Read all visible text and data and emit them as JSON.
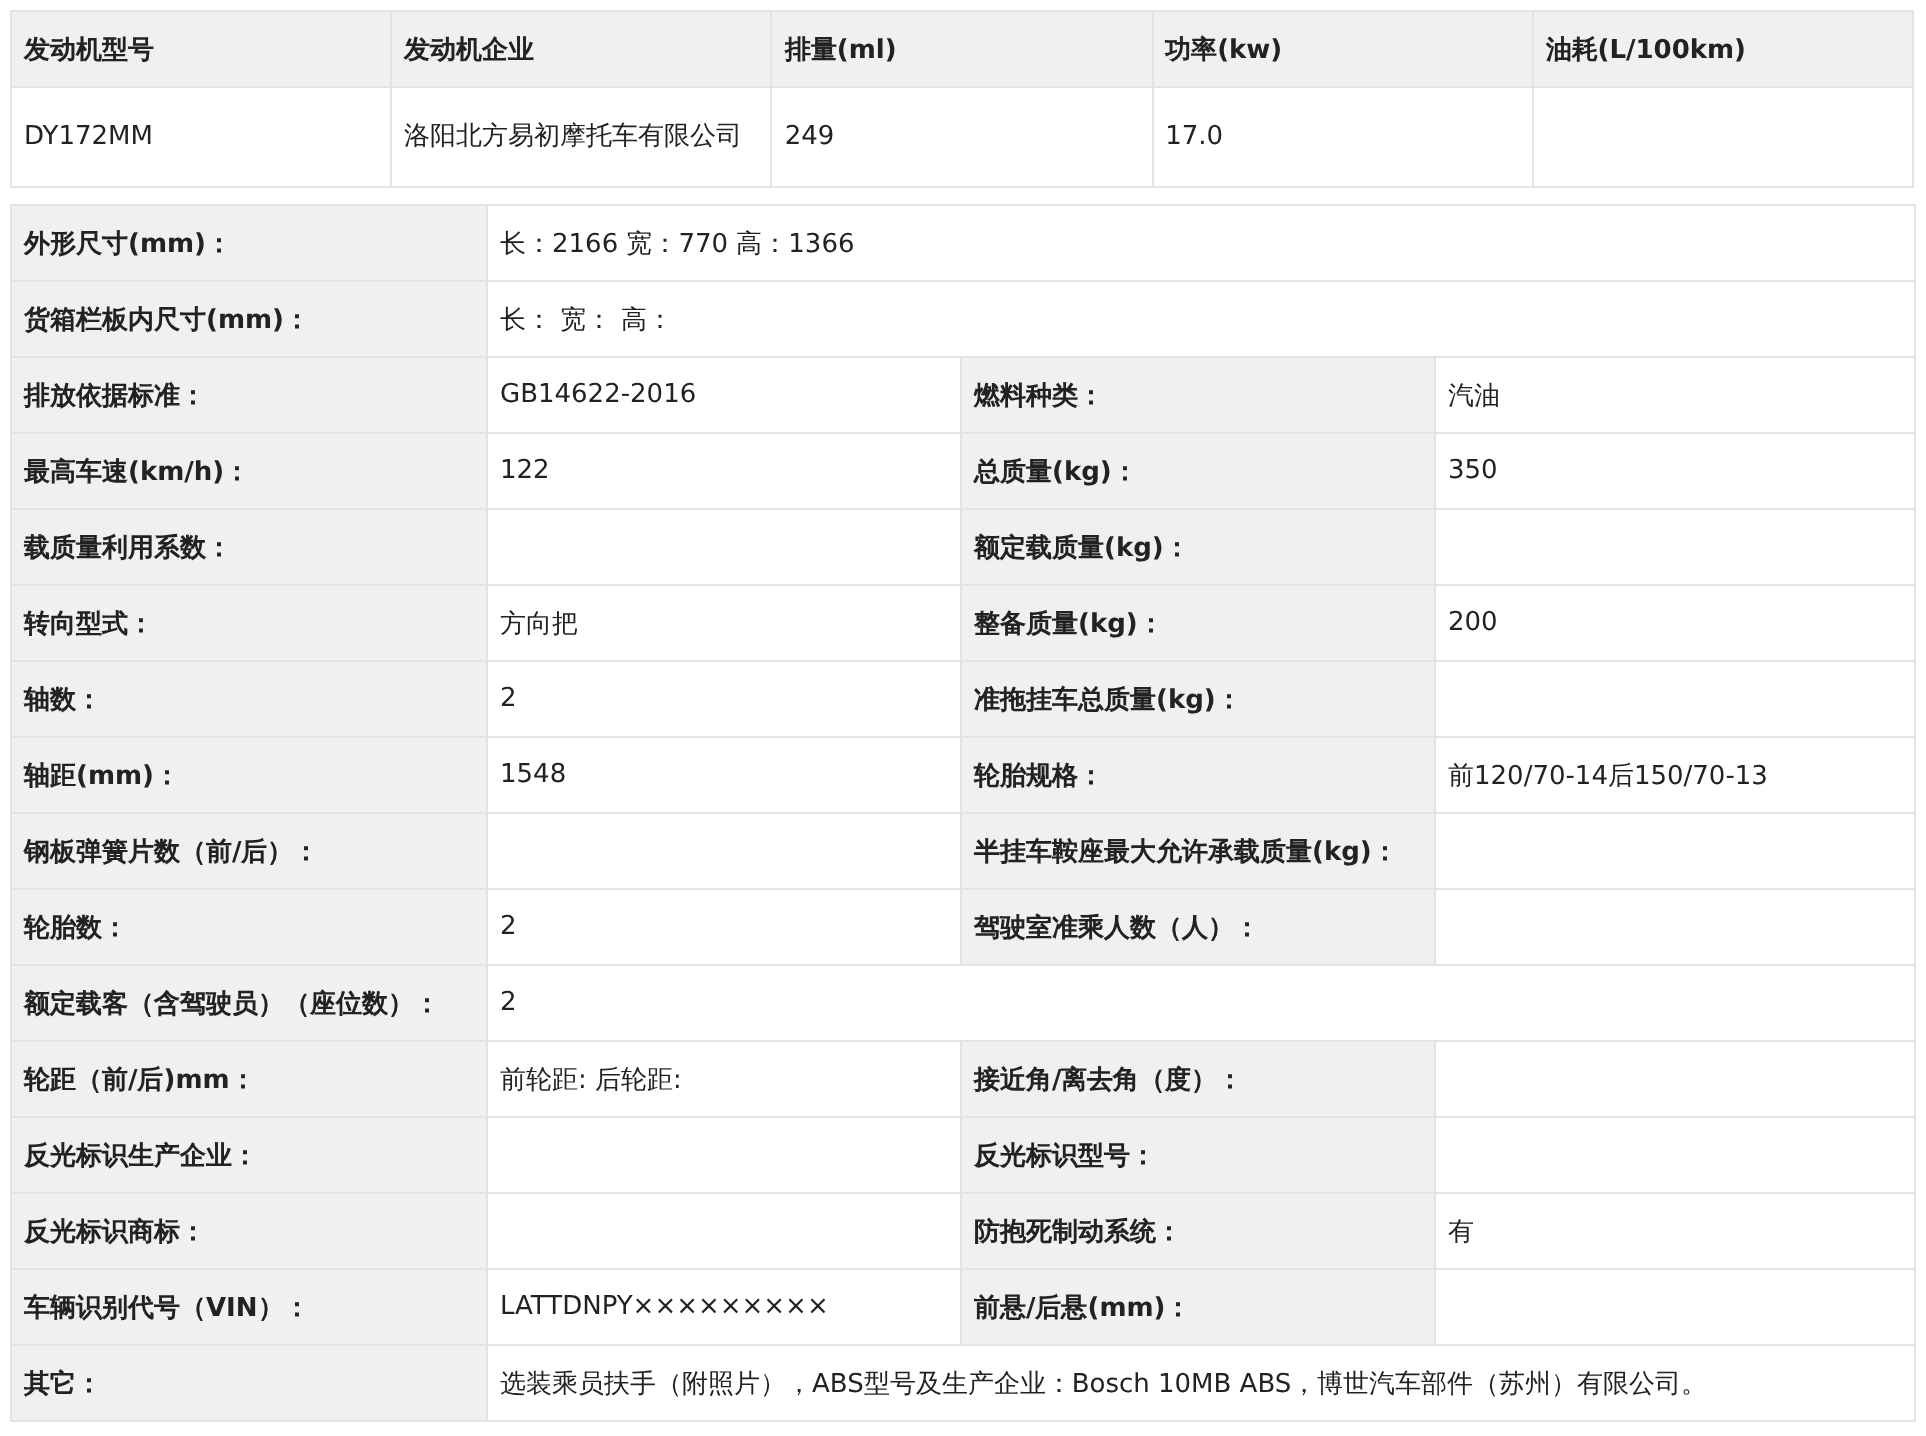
{
  "engine_table": {
    "columns": [
      "发动机型号",
      "发动机企业",
      "排量(ml)",
      "功率(kw)",
      "油耗(L/100km)"
    ],
    "rows": [
      {
        "cells": [
          "DY172MM",
          "洛阳北方易初摩托车有限公司",
          "249",
          "17.0",
          ""
        ]
      }
    ]
  },
  "spec_table": {
    "rows": [
      {
        "kind": "wide",
        "label": "外形尺寸(mm)：",
        "value": "长：2166 宽：770 高：1366"
      },
      {
        "kind": "wide",
        "label": "货箱栏板内尺寸(mm)：",
        "value": "长： 宽： 高："
      },
      {
        "kind": "pair",
        "label": "排放依据标准：",
        "value": "GB14622-2016",
        "label_2": "燃料种类：",
        "value_2": "汽油"
      },
      {
        "kind": "pair",
        "label": "最高车速(km/h)：",
        "value": "122",
        "label_2": "总质量(kg)：",
        "value_2": "350"
      },
      {
        "kind": "pair",
        "label": "载质量利用系数：",
        "label_2": "额定载质量(kg)："
      },
      {
        "kind": "pair",
        "label": "转向型式：",
        "value": "方向把",
        "label_2": "整备质量(kg)：",
        "value_2": "200"
      },
      {
        "kind": "pair",
        "label": "轴数：",
        "value": "2",
        "label_2": "准拖挂车总质量(kg)："
      },
      {
        "kind": "pair",
        "label": "轴距(mm)：",
        "value": "1548",
        "label_2": "轮胎规格：",
        "value_2": "前120/70-14后150/70-13"
      },
      {
        "kind": "pair",
        "label": "钢板弹簧片数（前/后）：",
        "label_2": "半挂车鞍座最大允许承载质量(kg)："
      },
      {
        "kind": "pair",
        "label": "轮胎数：",
        "value": "2",
        "label_2": "驾驶室准乘人数（人）："
      },
      {
        "kind": "wide",
        "label": "额定载客（含驾驶员）（座位数）：",
        "value": "2"
      },
      {
        "kind": "pair",
        "label": "轮距（前/后)mm：",
        "value": "前轮距: 后轮距:",
        "label_2": "接近角/离去角（度）："
      },
      {
        "kind": "pair",
        "label": "反光标识生产企业：",
        "label_2": "反光标识型号："
      },
      {
        "kind": "pair",
        "label": "反光标识商标：",
        "label_2": "防抱死制动系统：",
        "value_2": "有"
      },
      {
        "kind": "pair",
        "label": "车辆识别代号（VIN）：",
        "value": "LATTDNPY×××××××××",
        "label_2": "前悬/后悬(mm)："
      },
      {
        "kind": "wide",
        "label": "其它：",
        "value": "选装乘员扶手（附照片），ABS型号及生产企业：Bosch 10MB ABS，博世汽车部件（苏州）有限公司。"
      }
    ]
  }
}
